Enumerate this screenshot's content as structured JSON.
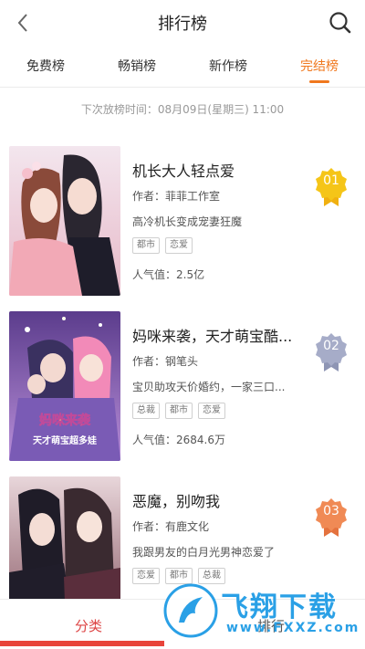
{
  "header": {
    "title": "排行榜",
    "back_icon": "back-icon",
    "search_icon": "search-icon"
  },
  "tabs": [
    {
      "label": "免费榜",
      "active": false
    },
    {
      "label": "畅销榜",
      "active": false
    },
    {
      "label": "新作榜",
      "active": false
    },
    {
      "label": "完结榜",
      "active": true
    }
  ],
  "schedule": "下次放榜时间：08月09日(星期三) 11:00",
  "items": [
    {
      "rank": "01",
      "title": "机长大人轻点爱",
      "author": "作者：菲菲工作室",
      "description": "高冷机长变成宠妻狂魔",
      "tags": [
        "都市",
        "恋爱"
      ],
      "popularity": "人气值：2.5亿",
      "badge_color": "#f5c518"
    },
    {
      "rank": "02",
      "title": "妈咪来袭，天才萌宝酷...",
      "author": "作者：钢笔头",
      "description": "宝贝助攻天价婚约，一家三口...",
      "tags": [
        "总裁",
        "都市",
        "恋爱"
      ],
      "popularity": "人气值：2684.6万",
      "cover_text": "妈咪来袭",
      "cover_subtext": "天才萌宝超多娃",
      "badge_color": "#a6acc8"
    },
    {
      "rank": "03",
      "title": "恶魔，别吻我",
      "author": "作者：有鹿文化",
      "description": "我跟男友的白月光男神恋爱了",
      "tags": [
        "恋爱",
        "都市",
        "总裁"
      ],
      "popularity": "",
      "badge_color": "#f08a55"
    }
  ],
  "bottom_tabs": [
    {
      "label": "分类",
      "active": true
    },
    {
      "label": "排行",
      "active": false
    }
  ],
  "watermark": {
    "text": "飞翔下载",
    "sub": "www.FXXZ.com"
  },
  "colors": {
    "accent": "#f0781e",
    "active_bottom": "#e8443a",
    "watermark": "#2aa0e6"
  }
}
